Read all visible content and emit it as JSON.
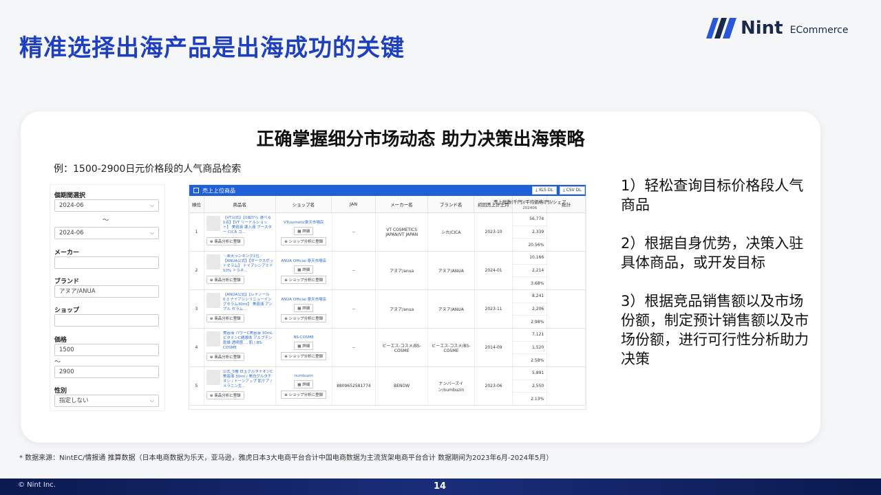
{
  "header": {
    "title": "精准选择出海产品是出海成功的关键",
    "logo_name": "Nint",
    "logo_sub": "ECommerce"
  },
  "card": {
    "heading": "正确掌握细分市场动态 助力决策出海策略",
    "example_label": "例：1500-2900日元价格段的人气商品检索"
  },
  "filter": {
    "period_label": "個期間選択",
    "period_from": "2024-06",
    "tilde": "〜",
    "period_to": "2024-06",
    "maker_label": "メーカー",
    "brand_label": "ブランド",
    "brand_value": "アヌア/ANUA",
    "shop_label": "ショップ",
    "price_label": "価格",
    "price_from": "1500",
    "price_tilde": "〜",
    "price_to": "2900",
    "gender_label": "性別",
    "gender_value": "指定しない"
  },
  "table": {
    "title": "売上上位商品",
    "xls_btn": "XLS DL",
    "csv_btn": "CSV DL",
    "columns": [
      "順位",
      "商品名",
      "ショップ名",
      "JAN",
      "メーカー名",
      "ブランド名",
      "初回売上計上月",
      "売上総数(千円)/平均価格(円)/シェア",
      "総計"
    ],
    "sub_col": "202406",
    "detail_label": "詳細",
    "analyze_label": "商品分析に登録",
    "shop_analyze_label": "ショップ分析に登録",
    "rows": [
      {
        "rank": "1",
        "product": "【VT公式】【1個から 選べる 1点】【VT リードルショット】 美容液 導入液 ブースター CICA コ...",
        "shop": "VTcosmetic楽天市場店",
        "jan": "--",
        "maker": "VT COSMETICS JAPAN/VT JAPAN",
        "brand": "シカ/CICA",
        "month": "2023-10",
        "v1": "56,774",
        "v2": "2,339",
        "v3": "20.56%"
      },
      {
        "rank": "2",
        "product": "＼楽天ランキング1位／【ANUA公式】【ダークスポットセラム】 ナイアシンアミド10% トラネ...",
        "shop": "ANUA Official 楽天市場店",
        "jan": "--",
        "maker": "アヌア/anua",
        "brand": "アヌア/ANUA",
        "month": "2024-01",
        "v1": "10,166",
        "v2": "2,214",
        "v3": "3.68%"
      },
      {
        "rank": "3",
        "product": "【ANUA公式】【レチノール0.3 ナイアシンリニューイングセラム30ml】 美容液 アンプル セラム...",
        "shop": "ANUA Official 楽天市場店",
        "jan": "--",
        "maker": "アヌア/anua",
        "brand": "アヌア/ANUA",
        "month": "2023-11",
        "v1": "8,241",
        "v2": "2,206",
        "v3": "2.98%"
      },
      {
        "rank": "4",
        "product": "美容液 パワーC美容液 30mL ビタミンC誘導体 アルブチン 乾燥 透明感 ... 肌 | BS-COSME",
        "shop": "BS-COSME",
        "jan": "--",
        "maker": "ビーエス-コスメ/BS-COSME",
        "brand": "ビーエス-コスメ/BS-COSME",
        "month": "2014-09",
        "v1": "7,121",
        "v2": "1,520",
        "v3": "2.58%"
      },
      {
        "rank": "5",
        "product": "公式_5種 白玉グルタチオンC 美容液 30ml / 美白グルタチオン / トーンアップ 肌ケア / メラニン生...",
        "shop": "numbuzin",
        "jan": "8809652581774",
        "maker": "BENOW",
        "brand": "ナンバーズイン/numbuzin",
        "month": "2023-06",
        "v1": "5,891",
        "v2": "2,550",
        "v3": "2.13%"
      }
    ]
  },
  "points": [
    "1）轻松查询目标价格段人气商品",
    "2）根据自身优势，决策入驻具体商品，或开发目标",
    "3）根据竞品销售额以及市场份额，制定预计销售额以及市场份额，进行可行性分析助力决策"
  ],
  "footnote": "* 数据来源：NintEC/情报通 推算数据（日本电商数据为乐天，亚马逊，雅虎日本3大电商平台合计中国电商数据为主流货架电商平台合计 数据期间为2023年6月-2024年5月）",
  "footer": {
    "copyright": "© Nint Inc.",
    "page_number": "14"
  }
}
